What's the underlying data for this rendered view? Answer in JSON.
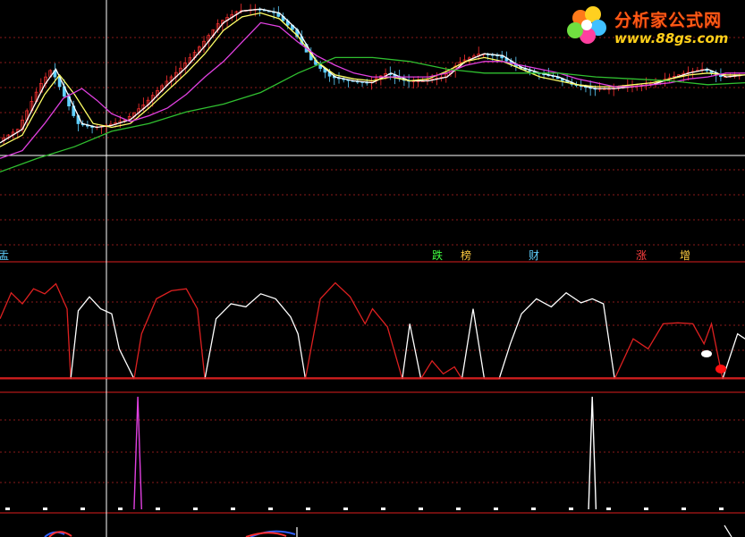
{
  "watermark": {
    "title": "分析家公式网",
    "url": "www.88gs.com"
  },
  "colors": {
    "background": "#000000",
    "grid": "#8a1a1a",
    "divider": "#b01818",
    "ma_fast": "#ffffff",
    "ma_mid": "#ffff66",
    "ma_magenta": "#e040e0",
    "ma_slow": "#30c030",
    "candle_up": "#ff3030",
    "candle_down": "#60d0ff",
    "osc_red": "#dd2020",
    "osc_white": "#ffffff",
    "spike_magenta": "#e040e0",
    "spike_white": "#ffffff"
  },
  "markers": [
    {
      "text": "盂",
      "color": "#60d0ff"
    },
    {
      "text": "跌",
      "color": "#40ff40"
    },
    {
      "text": "榜",
      "color": "#ffcc40"
    },
    {
      "text": "财",
      "color": "#60d0ff"
    },
    {
      "text": "涨",
      "color": "#ff4040"
    },
    {
      "text": "增",
      "color": "#ffcc40"
    }
  ],
  "chart_data": {
    "type": "line",
    "panels": [
      {
        "name": "price",
        "x_range": [
          0,
          200
        ],
        "y_range": [
          0,
          100
        ],
        "series": [
          {
            "id": "ma_fast",
            "color": "#ffffff",
            "points": [
              [
                0,
                30
              ],
              [
                6,
                37
              ],
              [
                12,
                60
              ],
              [
                15,
                68
              ],
              [
                18,
                56
              ],
              [
                22,
                40
              ],
              [
                26,
                38
              ],
              [
                30,
                39
              ],
              [
                35,
                42
              ],
              [
                40,
                50
              ],
              [
                45,
                60
              ],
              [
                50,
                69
              ],
              [
                55,
                80
              ],
              [
                60,
                92
              ],
              [
                65,
                98
              ],
              [
                70,
                99
              ],
              [
                75,
                97
              ],
              [
                80,
                88
              ],
              [
                85,
                72
              ],
              [
                90,
                64
              ],
              [
                95,
                62
              ],
              [
                100,
                61
              ],
              [
                105,
                66
              ],
              [
                110,
                62
              ],
              [
                115,
                62
              ],
              [
                120,
                64
              ],
              [
                125,
                72
              ],
              [
                130,
                76
              ],
              [
                135,
                75
              ],
              [
                140,
                69
              ],
              [
                145,
                66
              ],
              [
                150,
                64
              ],
              [
                155,
                60
              ],
              [
                160,
                58
              ],
              [
                165,
                58
              ],
              [
                170,
                59
              ],
              [
                175,
                60
              ],
              [
                180,
                63
              ],
              [
                185,
                66
              ],
              [
                190,
                68
              ],
              [
                195,
                64
              ],
              [
                200,
                65
              ]
            ]
          },
          {
            "id": "ma_mid",
            "color": "#ffff66",
            "points": [
              [
                0,
                28
              ],
              [
                6,
                34
              ],
              [
                12,
                55
              ],
              [
                16,
                65
              ],
              [
                20,
                55
              ],
              [
                25,
                40
              ],
              [
                30,
                38
              ],
              [
                35,
                40
              ],
              [
                40,
                48
              ],
              [
                45,
                57
              ],
              [
                50,
                66
              ],
              [
                55,
                76
              ],
              [
                60,
                88
              ],
              [
                65,
                95
              ],
              [
                70,
                97
              ],
              [
                75,
                94
              ],
              [
                80,
                85
              ],
              [
                85,
                72
              ],
              [
                90,
                65
              ],
              [
                95,
                63
              ],
              [
                100,
                62
              ],
              [
                105,
                64
              ],
              [
                110,
                62
              ],
              [
                115,
                63
              ],
              [
                120,
                67
              ],
              [
                125,
                72
              ],
              [
                130,
                74
              ],
              [
                135,
                72
              ],
              [
                140,
                68
              ],
              [
                145,
                64
              ],
              [
                150,
                62
              ],
              [
                155,
                60
              ],
              [
                160,
                59
              ],
              [
                165,
                59
              ],
              [
                170,
                60
              ],
              [
                175,
                61
              ],
              [
                180,
                63
              ],
              [
                185,
                65
              ],
              [
                190,
                66
              ],
              [
                195,
                65
              ],
              [
                200,
                65
              ]
            ]
          },
          {
            "id": "ma_magenta",
            "color": "#e040e0",
            "points": [
              [
                0,
                22
              ],
              [
                6,
                26
              ],
              [
                12,
                40
              ],
              [
                17,
                53
              ],
              [
                22,
                58
              ],
              [
                26,
                52
              ],
              [
                30,
                45
              ],
              [
                35,
                41
              ],
              [
                40,
                44
              ],
              [
                45,
                48
              ],
              [
                50,
                55
              ],
              [
                55,
                64
              ],
              [
                60,
                72
              ],
              [
                65,
                82
              ],
              [
                70,
                92
              ],
              [
                75,
                90
              ],
              [
                80,
                82
              ],
              [
                85,
                75
              ],
              [
                90,
                70
              ],
              [
                95,
                66
              ],
              [
                100,
                64
              ],
              [
                105,
                64
              ],
              [
                110,
                64
              ],
              [
                115,
                64
              ],
              [
                120,
                66
              ],
              [
                125,
                70
              ],
              [
                130,
                72
              ],
              [
                135,
                72
              ],
              [
                140,
                70
              ],
              [
                145,
                68
              ],
              [
                150,
                66
              ],
              [
                155,
                63
              ],
              [
                160,
                61
              ],
              [
                165,
                59
              ],
              [
                170,
                59
              ],
              [
                175,
                60
              ],
              [
                180,
                61
              ],
              [
                185,
                63
              ],
              [
                190,
                64
              ],
              [
                195,
                66
              ],
              [
                200,
                66
              ]
            ]
          },
          {
            "id": "ma_slow",
            "color": "#30c030",
            "points": [
              [
                0,
                15
              ],
              [
                10,
                22
              ],
              [
                20,
                28
              ],
              [
                30,
                36
              ],
              [
                40,
                40
              ],
              [
                50,
                46
              ],
              [
                60,
                50
              ],
              [
                70,
                56
              ],
              [
                80,
                66
              ],
              [
                90,
                74
              ],
              [
                100,
                74
              ],
              [
                110,
                72
              ],
              [
                120,
                68
              ],
              [
                130,
                66
              ],
              [
                140,
                66
              ],
              [
                150,
                66
              ],
              [
                160,
                64
              ],
              [
                170,
                63
              ],
              [
                180,
                62
              ],
              [
                190,
                60
              ],
              [
                200,
                61
              ]
            ]
          }
        ]
      },
      {
        "name": "oscillator",
        "x_range": [
          0,
          200
        ],
        "y_range": [
          0,
          100
        ],
        "series": [
          {
            "id": "osc",
            "color_segments": [
              "#dd2020",
              "#ffffff"
            ],
            "points": [
              [
                0,
                60
              ],
              [
                3,
                86
              ],
              [
                6,
                75
              ],
              [
                9,
                90
              ],
              [
                12,
                85
              ],
              [
                15,
                95
              ],
              [
                18,
                70
              ],
              [
                19,
                0
              ],
              [
                21,
                68
              ],
              [
                24,
                82
              ],
              [
                27,
                70
              ],
              [
                30,
                65
              ],
              [
                32,
                30
              ],
              [
                36,
                0
              ],
              [
                38,
                45
              ],
              [
                42,
                80
              ],
              [
                46,
                88
              ],
              [
                50,
                90
              ],
              [
                53,
                70
              ],
              [
                55,
                0
              ],
              [
                58,
                60
              ],
              [
                62,
                75
              ],
              [
                66,
                72
              ],
              [
                70,
                85
              ],
              [
                74,
                80
              ],
              [
                78,
                62
              ],
              [
                80,
                45
              ],
              [
                82,
                0
              ],
              [
                86,
                80
              ],
              [
                90,
                96
              ],
              [
                94,
                82
              ],
              [
                98,
                55
              ],
              [
                100,
                70
              ],
              [
                104,
                52
              ],
              [
                108,
                0
              ],
              [
                110,
                55
              ],
              [
                113,
                0
              ],
              [
                116,
                18
              ],
              [
                119,
                5
              ],
              [
                122,
                12
              ],
              [
                124,
                0
              ],
              [
                127,
                70
              ],
              [
                130,
                0
              ],
              [
                134,
                0
              ],
              [
                137,
                35
              ],
              [
                140,
                65
              ],
              [
                144,
                80
              ],
              [
                148,
                72
              ],
              [
                152,
                86
              ],
              [
                156,
                76
              ],
              [
                159,
                80
              ],
              [
                162,
                75
              ],
              [
                165,
                0
              ],
              [
                170,
                40
              ],
              [
                174,
                30
              ],
              [
                178,
                55
              ],
              [
                182,
                56
              ],
              [
                186,
                55
              ],
              [
                189,
                35
              ],
              [
                191,
                55
              ],
              [
                194,
                0
              ],
              [
                198,
                45
              ],
              [
                200,
                40
              ]
            ]
          }
        ]
      },
      {
        "name": "signal",
        "x_range": [
          0,
          200
        ],
        "y_range": [
          0,
          100
        ],
        "series": [
          {
            "id": "spike_magenta",
            "color": "#e040e0",
            "points": [
              [
                36,
                0
              ],
              [
                37,
                100
              ],
              [
                38,
                0
              ]
            ]
          },
          {
            "id": "spike_white",
            "color": "#ffffff",
            "points": [
              [
                158,
                0
              ],
              [
                159,
                100
              ],
              [
                160,
                0
              ]
            ]
          }
        ]
      }
    ]
  }
}
